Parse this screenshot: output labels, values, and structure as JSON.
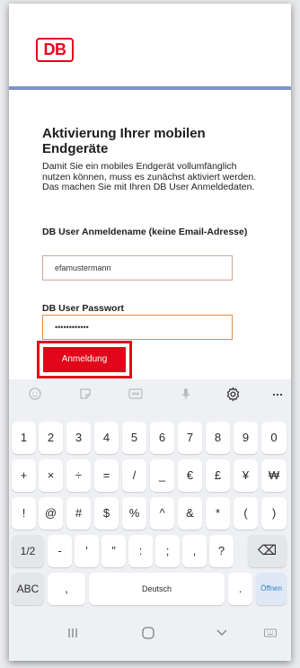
{
  "logo": {
    "text": "DB"
  },
  "page": {
    "title": "Aktivierung Ihrer mobilen Endgeräte",
    "description": "Damit Sie ein mobiles Endgerät vollumfänglich nutzen können, muss es zunächst aktiviert werden. Das machen Sie mit Ihren DB User Anmeldedaten.",
    "username_label": "DB User Anmeldename (keine Email-Adresse)",
    "username_value": "efamustermann",
    "password_label": "DB User Passwort",
    "password_value": "••••••••••••",
    "login_button": "Anmeldung"
  },
  "keyboard": {
    "toolbar_icons": [
      "emoji-icon",
      "sticker-icon",
      "gif-icon",
      "microphone-icon",
      "settings-icon",
      "more-icon"
    ],
    "row1": [
      "1",
      "2",
      "3",
      "4",
      "5",
      "6",
      "7",
      "8",
      "9",
      "0"
    ],
    "row2": [
      "+",
      "×",
      "÷",
      "=",
      "/",
      "_",
      "€",
      "£",
      "¥",
      "₩"
    ],
    "row3": [
      "!",
      "@",
      "#",
      "$",
      "%",
      "^",
      "&",
      "*",
      "(",
      ")"
    ],
    "row4": [
      "1/2",
      "-",
      "'",
      "\"",
      ":",
      ";",
      ",",
      "?",
      "⌫"
    ],
    "row5": {
      "abc": "ABC",
      "comma": ",",
      "space": "Deutsch",
      "period": ".",
      "enter": "Öffnen"
    }
  },
  "navbar": {
    "icons": [
      "recent-apps-icon",
      "home-icon",
      "back-icon",
      "keyboard-switch-icon"
    ]
  }
}
